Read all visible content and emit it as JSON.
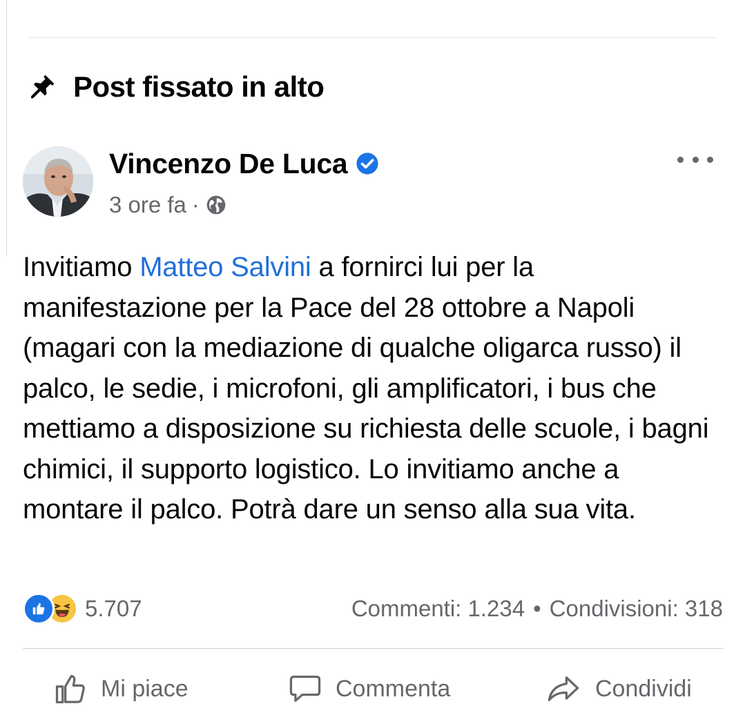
{
  "pinned": {
    "icon": "pin-icon",
    "title": "Post fissato in alto"
  },
  "post": {
    "author": "Vincenzo De Luca",
    "verified_icon": "verified-badge-icon",
    "time": "3 ore fa",
    "separator": "·",
    "audience_icon": "globe-icon",
    "body": {
      "prefix": "Invitiamo ",
      "mention": "Matteo Salvini",
      "rest": " a fornirci lui per la manifestazione per la Pace del 28 ottobre a Napoli (magari con la mediazione di qualche oligarca russo) il palco, le sedie, i microfoni, gli amplificatori, i bus che mettiamo a disposizione su richiesta delle scuole, i bagni chimici, il supporto logistico. Lo invitiamo anche a montare il palco. Potrà dare un senso alla sua vita."
    },
    "reactions": {
      "types": [
        "like",
        "haha"
      ],
      "count": "5.707"
    },
    "stats": {
      "comments": "Commenti: 1.234",
      "bullet": "•",
      "shares": "Condivisioni: 318"
    }
  },
  "actions": {
    "like_label": "Mi piace",
    "comment_label": "Commenta",
    "share_label": "Condividi"
  },
  "colors": {
    "accent": "#1b74e4",
    "mention": "#216fdb",
    "muted": "#65676b",
    "haha": "#f7c542"
  }
}
